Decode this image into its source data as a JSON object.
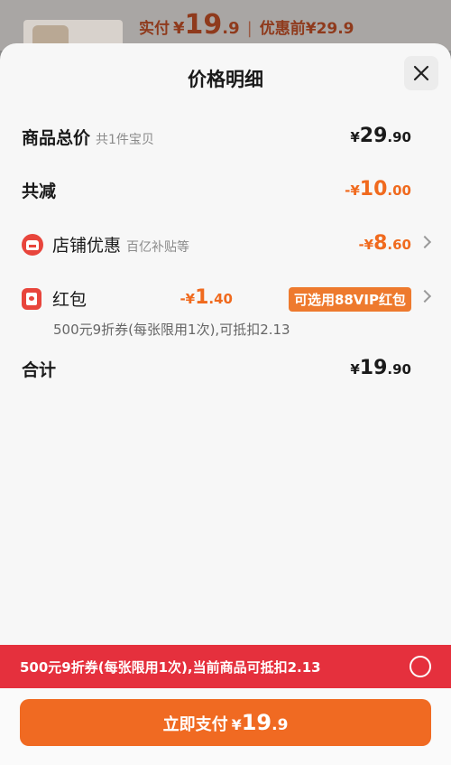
{
  "top": {
    "label": "实付",
    "yen": "¥",
    "price_int": "19",
    "price_dec": ".9",
    "separator": "|",
    "before_label": "优惠前¥29.9"
  },
  "sheet": {
    "title": "价格明细",
    "close_icon": "close-icon"
  },
  "rows": {
    "total": {
      "label": "商品总价",
      "sub": "共1件宝贝",
      "sym": "¥",
      "int": "29",
      "dec": ".90"
    },
    "reduce": {
      "label": "共减",
      "sym": "-¥",
      "int": "10",
      "dec": ".00"
    },
    "store": {
      "label": "店铺优惠",
      "sub": "百亿补贴等",
      "sym": "-¥",
      "int": "8",
      "dec": ".60",
      "icon": "store-icon"
    },
    "redpacket": {
      "label": "红包",
      "sym": "-¥",
      "int": "1",
      "dec": ".40",
      "tag": "可选用88VIP红包",
      "icon": "red-packet-icon",
      "detail": "500元9折券(每张限用1次),可抵扣2.13"
    },
    "sum": {
      "label": "合计",
      "sym": "¥",
      "int": "19",
      "dec": ".90"
    }
  },
  "banner": {
    "text": "500元9折券(每张限用1次),当前商品可抵扣2.13"
  },
  "pay": {
    "label": "立即支付",
    "sym": "¥",
    "int": "19",
    "dec": ".9"
  },
  "colors": {
    "accent": "#f06a22",
    "banner": "#e5303d",
    "discount": "#f06a1e"
  }
}
